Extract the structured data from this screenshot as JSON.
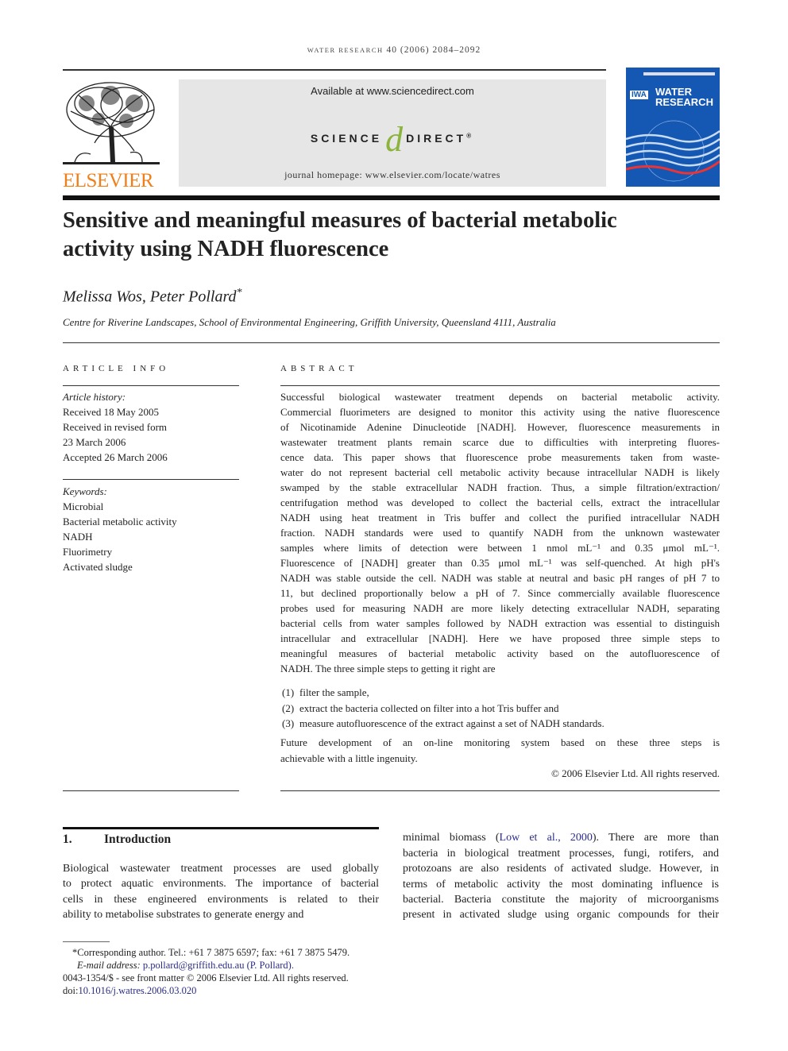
{
  "running_header": {
    "journal": "water research",
    "citation": "40 (2006) 2084–2092"
  },
  "publisher": {
    "name": "ELSEVIER",
    "logo": "elsevier-tree-logo"
  },
  "banner": {
    "available": "Available at www.sciencedirect.com",
    "sd_left": "SCIENCE",
    "sd_at": "d",
    "sd_right": "DIRECT",
    "sd_reg": "®",
    "homepage": "journal homepage: www.elsevier.com/locate/watres"
  },
  "cover": {
    "iwa": "IWA",
    "title1": "WATER",
    "title2": "RESEARCH"
  },
  "colors": {
    "elsevier_orange": "#f07f1a",
    "sd_green": "#8ab43c",
    "cover_blue": "#1558b4",
    "link": "#2b2b8c"
  },
  "title": [
    "Sensitive and meaningful measures of bacterial metabolic",
    "activity using NADH fluorescence"
  ],
  "authors": "Melissa Wos, Peter Pollard",
  "author_mark": "*",
  "affiliation": "Centre for Riverine Landscapes, School of Environmental Engineering, Griffith University, Queensland 4111, Australia",
  "article_info": {
    "heading": "ARTICLE INFO",
    "history_label": "Article history:",
    "history": [
      "Received 18 May 2005",
      "Received in revised form",
      "23 March 2006",
      "Accepted 26 March 2006"
    ],
    "keywords_label": "Keywords:",
    "keywords": [
      "Microbial",
      "Bacterial metabolic activity",
      "NADH",
      "Fluorimetry",
      "Activated sludge"
    ]
  },
  "abstract": {
    "heading": "ABSTRACT",
    "lines": [
      "Successful biological wastewater treatment depends on bacterial metabolic activity.",
      "Commercial fluorimeters are designed to monitor this activity using the native fluorescence",
      "of Nicotinamide Adenine Dinucleotide [NADH]. However, fluorescence measurements in",
      "wastewater treatment plants remain scarce due to difficulties with interpreting fluores-",
      "cence data. This paper shows that fluorescence probe measurements taken from waste-",
      "water do not represent bacterial cell metabolic activity because intracellular NADH is likely",
      "swamped by the stable extracellular NADH fraction. Thus, a simple filtration/extraction/",
      "centrifugation method was developed to collect the bacterial cells, extract the intracellular",
      "NADH using heat treatment in Tris buffer and collect the purified intracellular NADH",
      "fraction. NADH standards were used to quantify NADH from the unknown wastewater",
      "samples where limits of detection were between 1 nmol mL⁻¹ and 0.35 μmol mL⁻¹.",
      "Fluorescence of [NADH] greater than 0.35 μmol mL⁻¹ was self-quenched. At high pH's",
      "NADH was stable outside the cell. NADH was stable at neutral and basic pH ranges of pH 7 to",
      "11, but declined proportionally below a pH of 7. Since commercially available fluorescence",
      "probes used for measuring NADH are more likely detecting extracellular NADH, separating",
      "bacterial cells from water samples followed by NADH extraction was essential to distinguish",
      "intracellular and extracellular [NADH]. Here we have proposed three simple steps to",
      "meaningful measures of bacterial metabolic activity based on the autofluorescence of",
      "NADH. The three simple steps to getting it right are"
    ],
    "steps": [
      {
        "num": "(1)",
        "text": "filter the sample,"
      },
      {
        "num": "(2)",
        "text": "extract the bacteria collected on filter into a hot Tris buffer and"
      },
      {
        "num": "(3)",
        "text": "measure autofluorescence of the extract against a set of NADH standards."
      }
    ],
    "closing": [
      "Future development of an on-line monitoring system based on these three steps is",
      "achievable with a little ingenuity."
    ],
    "copyright": "© 2006 Elsevier Ltd. All rights reserved."
  },
  "intro": {
    "number": "1.",
    "heading": "Introduction",
    "left_lines": [
      "Biological wastewater treatment processes are used globally",
      "to protect aquatic environments. The importance of bacterial",
      "cells in these engineered environments is related to their",
      "ability to metabolise substrates to generate energy and"
    ],
    "right_first_pre": "minimal biomass (",
    "right_first_link": "Low et al., 2000",
    "right_first_post": "). There are more than",
    "right_lines": [
      "bacteria in biological treatment processes, fungi, rotifers, and",
      "protozoans are also residents of activated sludge. However, in",
      "terms of metabolic activity the most dominating influence is",
      "bacterial. Bacteria constitute the majority of microorganisms",
      "present in activated sludge using organic compounds for their"
    ]
  },
  "footnotes": {
    "corresponding": "*Corresponding author. Tel.: +61 7 3875 6597; fax: +61 7 3875 5479.",
    "email_label": "E-mail address:",
    "email": "p.pollard@griffith.edu.au (P. Pollard).",
    "front_matter": "0043-1354/$ - see front matter © 2006 Elsevier Ltd. All rights reserved.",
    "doi_label": "doi:",
    "doi": "10.1016/j.watres.2006.03.020"
  }
}
